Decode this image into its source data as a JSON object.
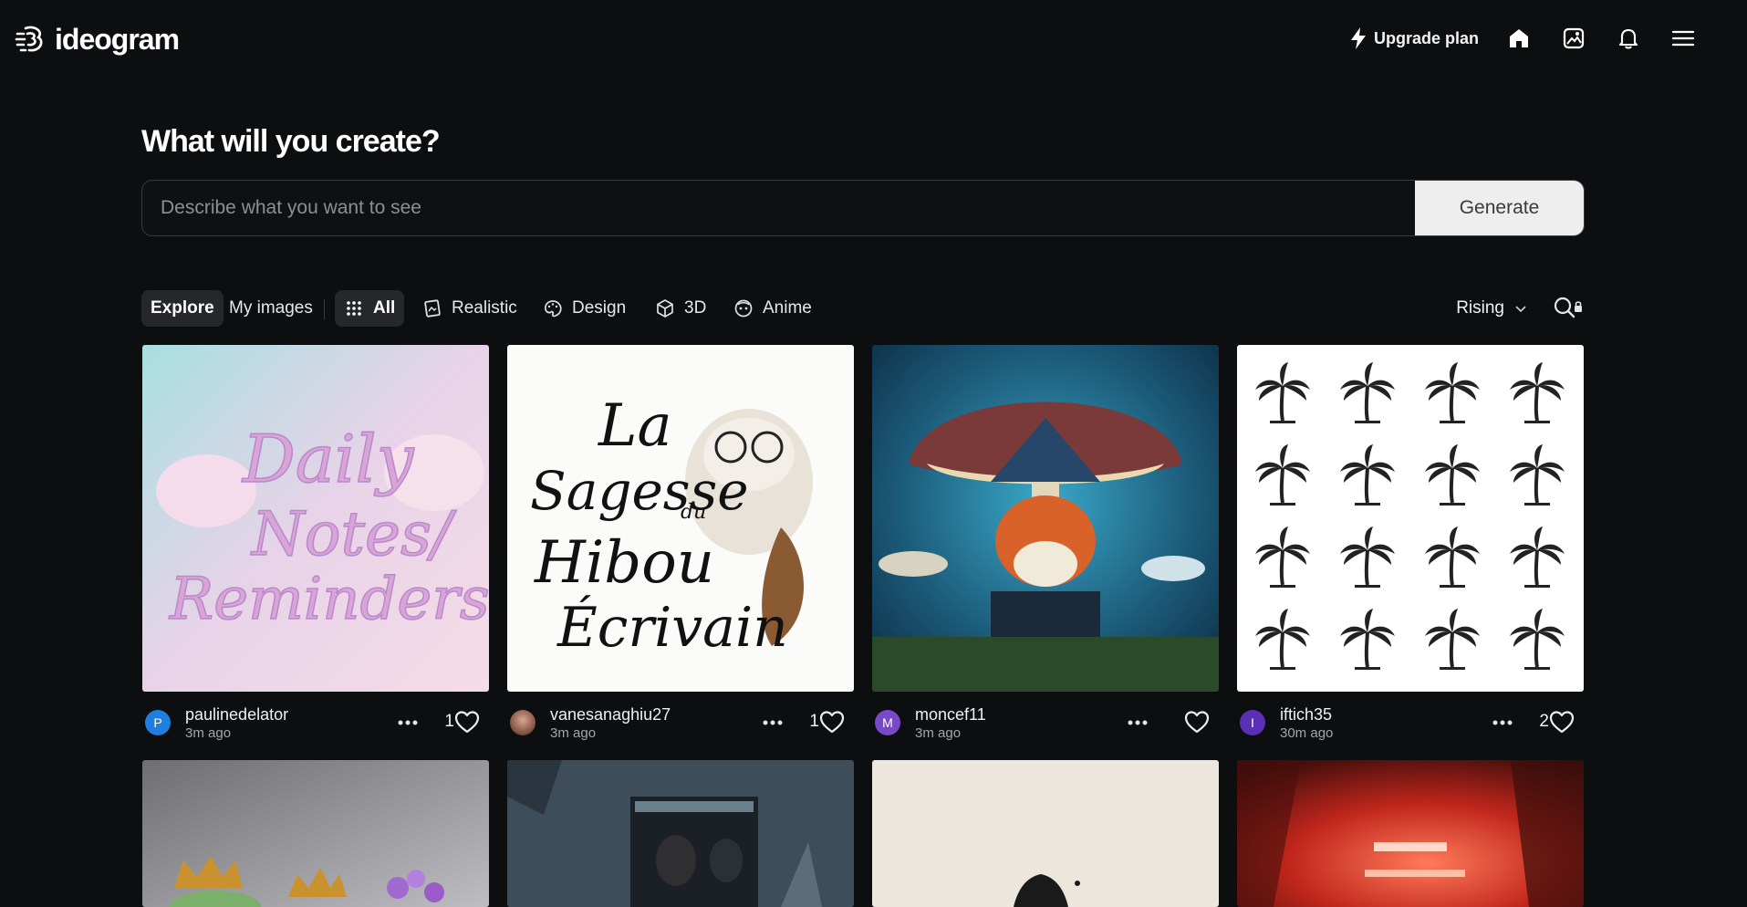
{
  "brand": {
    "name": "ideogram"
  },
  "header": {
    "upgrade_label": "Upgrade plan",
    "icons": [
      "home-icon",
      "gallery-icon",
      "bell-icon",
      "menu-icon"
    ]
  },
  "hero": {
    "title": "What will you create?",
    "prompt_placeholder": "Describe what you want to see",
    "prompt_value": "",
    "generate_label": "Generate"
  },
  "filters": {
    "tabs": [
      "Explore",
      "My images"
    ],
    "active_tab": "Explore",
    "categories": [
      "All",
      "Realistic",
      "Design",
      "3D",
      "Anime"
    ],
    "active_category": "All",
    "sort": "Rising"
  },
  "images": [
    {
      "user": "paulinedelator",
      "time": "3m ago",
      "likes": "1",
      "avatar_letter": "P",
      "avatar_color": "#1f7fe0",
      "alt": "Daily Notes / Reminders"
    },
    {
      "user": "vanesanaghiu27",
      "time": "3m ago",
      "likes": "1",
      "avatar_letter": "",
      "avatar_color": "#8a5a4a",
      "alt": "La Sagesse du Hibou Ecrivain"
    },
    {
      "user": "moncef11",
      "time": "3m ago",
      "likes": "",
      "avatar_letter": "M",
      "avatar_color": "#7a49c9",
      "alt": "fox wizard reading under mushroom"
    },
    {
      "user": "iftich35",
      "time": "30m ago",
      "likes": "2",
      "avatar_letter": "I",
      "avatar_color": "#5a2fb5",
      "alt": "palm tree silhouettes"
    }
  ],
  "colors": {
    "background": "#0d0e10",
    "panel": "#26272b",
    "button": "#eeeeee"
  }
}
